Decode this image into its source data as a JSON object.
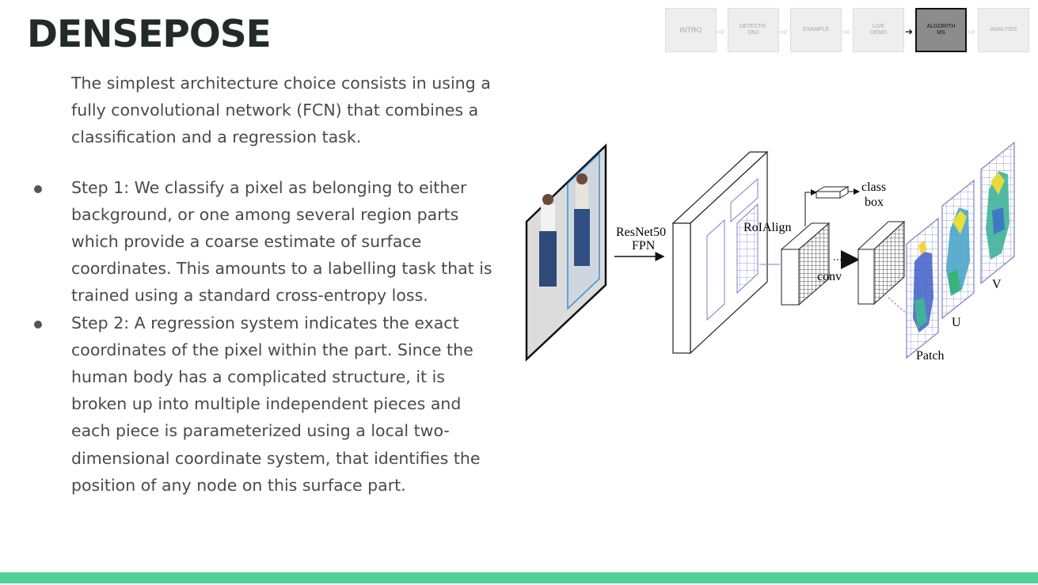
{
  "slide": {
    "title": "DENSEPOSE",
    "intro": "The simplest architecture choice consists in using a fully convolutional network (FCN) that combines a classification and a regression task.",
    "bullets": [
      "Step 1: We classify a pixel as belonging to either background, or one among several region parts which provide a coarse estimate of surface coordinates. This amounts to a labelling task that is trained using a standard cross-entropy loss.",
      "Step 2: A regression system indicates the exact coordinates of the pixel within the part. Since the human body has a complicated structure, it is broken up into multiple independent pieces and each piece is parameterized using a local two-dimensional coordinate system, that identifies the position of any node on this surface part."
    ]
  },
  "nav": {
    "intro": "INTRO",
    "detectron2_l1": "DETECTR-",
    "detectron2_l2": "ON2",
    "example": "EXAMPLE",
    "live_demo_l1": "LIVE",
    "live_demo_l2": "DEMO",
    "algorithms_l1": "ALGORITH",
    "algorithms_l2": "MS",
    "analysis": "ANALYSIS"
  },
  "diagram": {
    "backbone_l1": "ResNet50",
    "backbone_l2": "FPN",
    "roialign": "RoIAlign",
    "class_l1": "class",
    "class_l2": "box",
    "conv": "conv",
    "patch": "Patch",
    "u": "U",
    "v": "V"
  },
  "colors": {
    "accent_bar": "#4fd19a",
    "title": "#222a2a",
    "body_text": "#4a4a4a",
    "nav_active": "#8c8c8c"
  }
}
